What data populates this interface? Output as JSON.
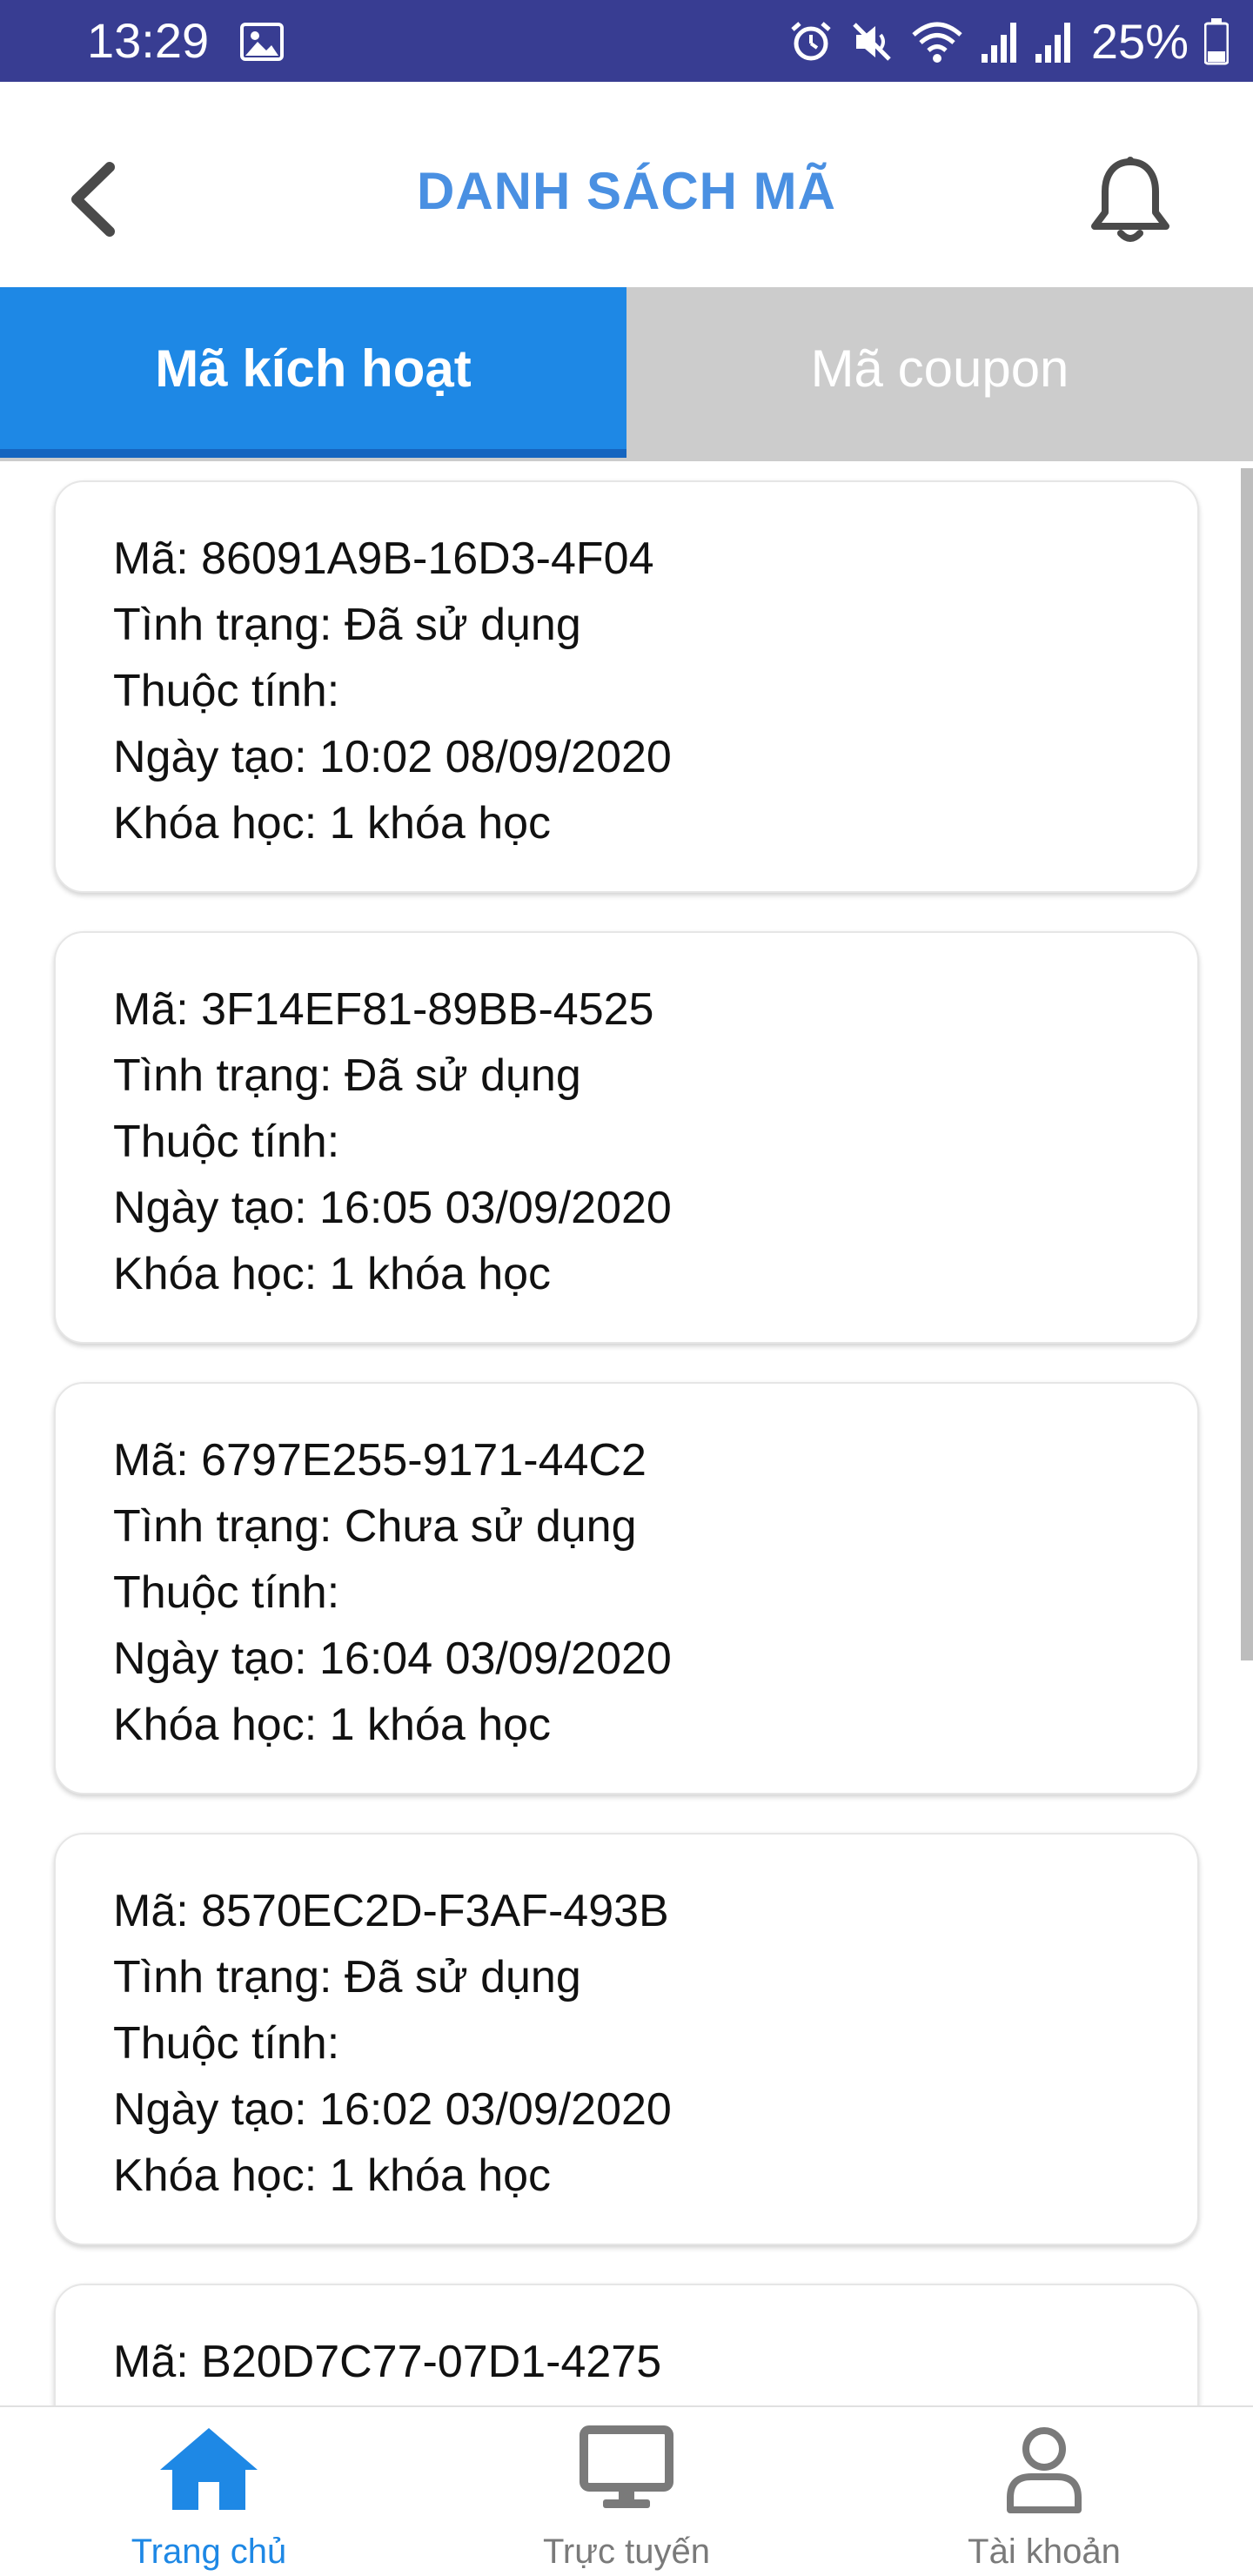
{
  "status_bar": {
    "time": "13:29",
    "battery": "25%",
    "icons": [
      "gallery-icon",
      "alarm-icon",
      "mute-icon",
      "wifi-icon",
      "signal-icon",
      "signal-icon",
      "battery-icon"
    ]
  },
  "header": {
    "title": "DANH SÁCH MÃ",
    "back_icon": "chevron-left-icon",
    "notification_icon": "bell-icon"
  },
  "tabs": [
    {
      "label": "Mã kích hoạt",
      "active": true
    },
    {
      "label": "Mã coupon",
      "active": false
    }
  ],
  "codes": [
    {
      "code": "Mã: 86091A9B-16D3-4F04",
      "status": "Tình trạng: Đã sử dụng",
      "attribute": "Thuộc tính:",
      "created": "Ngày tạo: 10:02 08/09/2020",
      "courses": "Khóa học: 1 khóa học"
    },
    {
      "code": "Mã: 3F14EF81-89BB-4525",
      "status": "Tình trạng: Đã sử dụng",
      "attribute": "Thuộc tính:",
      "created": "Ngày tạo: 16:05 03/09/2020",
      "courses": "Khóa học: 1 khóa học"
    },
    {
      "code": "Mã: 6797E255-9171-44C2",
      "status": "Tình trạng: Chưa sử dụng",
      "attribute": "Thuộc tính:",
      "created": "Ngày tạo: 16:04 03/09/2020",
      "courses": "Khóa học: 1 khóa học"
    },
    {
      "code": "Mã: 8570EC2D-F3AF-493B",
      "status": "Tình trạng: Đã sử dụng",
      "attribute": "Thuộc tính:",
      "created": "Ngày tạo: 16:02 03/09/2020",
      "courses": "Khóa học: 1 khóa học"
    },
    {
      "code": "Mã: B20D7C77-07D1-4275"
    }
  ],
  "bottom_nav": [
    {
      "label": "Trang chủ",
      "icon": "home-icon",
      "active": true
    },
    {
      "label": "Trực tuyến",
      "icon": "monitor-icon",
      "active": false
    },
    {
      "label": "Tài khoản",
      "icon": "user-icon",
      "active": false
    }
  ],
  "colors": {
    "status_bar": "#383d92",
    "title": "#4a90e2",
    "tab_active": "#1e88e5",
    "tab_inactive": "#cccccc",
    "nav_active": "#1e88e5",
    "nav_inactive": "#7a7a7a"
  }
}
